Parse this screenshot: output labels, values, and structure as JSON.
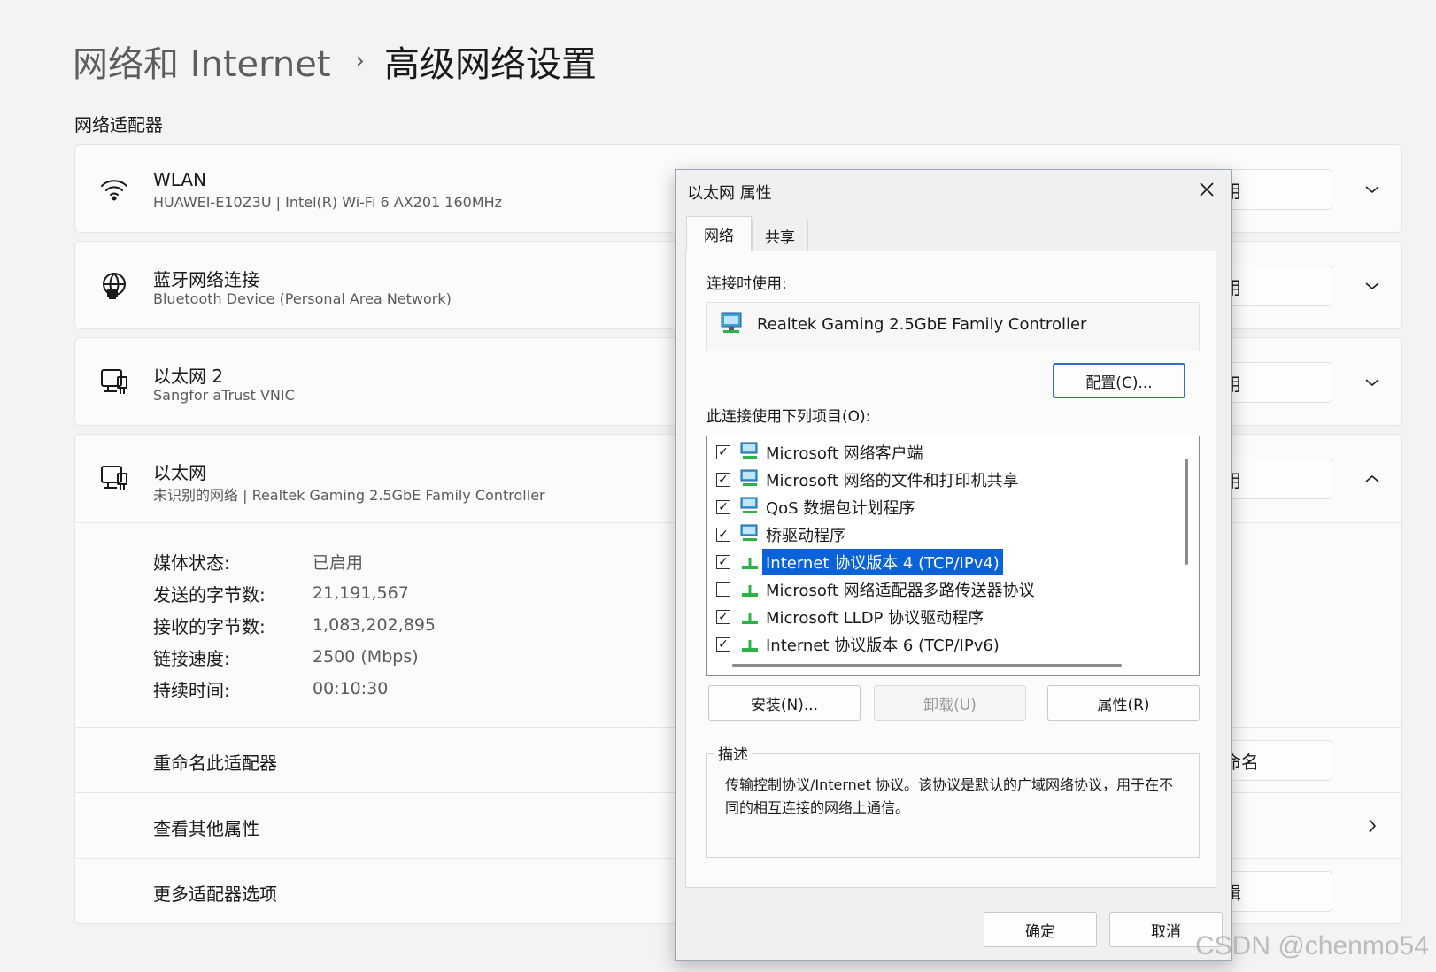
{
  "breadcrumb": {
    "parent": "网络和 Internet",
    "separator": "›",
    "current": "高级网络设置"
  },
  "section_title": "网络适配器",
  "adapters": [
    {
      "name": "WLAN",
      "subtitle": "HUAWEI-E10Z3U | Intel(R) Wi-Fi 6 AX201 160MHz",
      "button": "禁用",
      "icon": "wifi-icon",
      "expanded": false
    },
    {
      "name": "蓝牙网络连接",
      "subtitle": "Bluetooth Device (Personal Area Network)",
      "button": "禁用",
      "icon": "globe-network-icon",
      "expanded": false
    },
    {
      "name": "以太网 2",
      "subtitle": "Sangfor aTrust VNIC",
      "button": "启用",
      "icon": "ethernet-icon",
      "expanded": false
    },
    {
      "name": "以太网",
      "subtitle": "未识别的网络 | Realtek Gaming 2.5GbE Family Controller",
      "button": "禁用",
      "icon": "ethernet-icon",
      "expanded": true
    }
  ],
  "ethernet_details": {
    "stats": [
      {
        "label": "媒体状态:",
        "value": "已启用"
      },
      {
        "label": "发送的字节数:",
        "value": "21,191,567"
      },
      {
        "label": "接收的字节数:",
        "value": "1,083,202,895"
      },
      {
        "label": "链接速度:",
        "value": "2500 (Mbps)"
      },
      {
        "label": "持续时间:",
        "value": "00:10:30"
      }
    ],
    "rename_label": "重命名此适配器",
    "rename_button": "重命名",
    "view_props_label": "查看其他属性",
    "more_options_label": "更多适配器选项",
    "edit_button": "编辑"
  },
  "dialog": {
    "title": "以太网 属性",
    "tabs": [
      "网络",
      "共享"
    ],
    "active_tab": "网络",
    "connect_using_label": "连接时使用:",
    "device_name": "Realtek Gaming 2.5GbE Family Controller",
    "configure_button": "配置(C)...",
    "items_label": "此连接使用下列项目(O):",
    "items": [
      {
        "label": "Microsoft 网络客户端",
        "checked": true,
        "icon": "network-client-icon",
        "selected": false
      },
      {
        "label": "Microsoft 网络的文件和打印机共享",
        "checked": true,
        "icon": "network-client-icon",
        "selected": false
      },
      {
        "label": "QoS 数据包计划程序",
        "checked": true,
        "icon": "network-client-icon",
        "selected": false
      },
      {
        "label": "桥驱动程序",
        "checked": true,
        "icon": "network-client-icon",
        "selected": false
      },
      {
        "label": "Internet 协议版本 4 (TCP/IPv4)",
        "checked": true,
        "icon": "protocol-icon",
        "selected": true
      },
      {
        "label": "Microsoft 网络适配器多路传送器协议",
        "checked": false,
        "icon": "protocol-icon",
        "selected": false
      },
      {
        "label": "Microsoft LLDP 协议驱动程序",
        "checked": true,
        "icon": "protocol-icon",
        "selected": false
      },
      {
        "label": "Internet 协议版本 6 (TCP/IPv6)",
        "checked": true,
        "icon": "protocol-icon",
        "selected": false
      }
    ],
    "install_button": "安装(N)...",
    "uninstall_button": "卸载(U)",
    "properties_button": "属性(R)",
    "description_legend": "描述",
    "description_text": "传输控制协议/Internet 协议。该协议是默认的广域网络协议，用于在不同的相互连接的网络上通信。",
    "ok_button": "确定",
    "cancel_button": "取消"
  },
  "watermark": "CSDN @chenmo54",
  "colors": {
    "accent": "#0a63d6",
    "page_bg": "#f3f3f3",
    "card_bg": "#fbfbfb"
  }
}
